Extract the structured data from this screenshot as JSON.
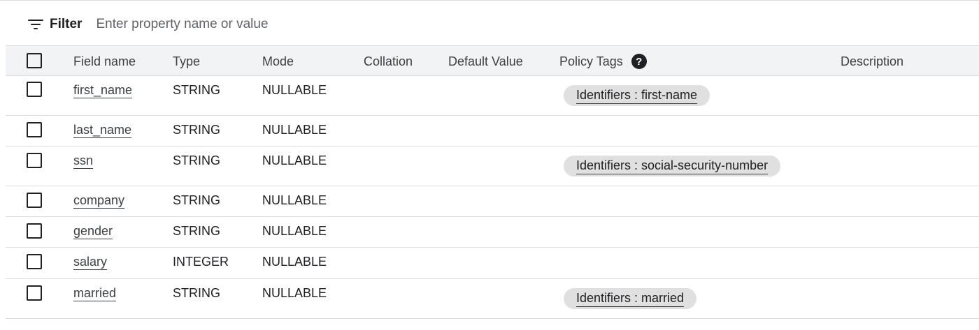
{
  "filter": {
    "label": "Filter",
    "placeholder": "Enter property name or value",
    "icon": "filter-list-icon"
  },
  "columns": {
    "field_name": "Field name",
    "type": "Type",
    "mode": "Mode",
    "collation": "Collation",
    "default_value": "Default Value",
    "policy_tags": "Policy Tags",
    "policy_tags_help": "?",
    "description": "Description"
  },
  "rows": [
    {
      "field_name": "first_name",
      "type": "STRING",
      "mode": "NULLABLE",
      "collation": "",
      "default_value": "",
      "policy_tag": "Identifiers : first-name",
      "description": ""
    },
    {
      "field_name": "last_name",
      "type": "STRING",
      "mode": "NULLABLE",
      "collation": "",
      "default_value": "",
      "policy_tag": "",
      "description": ""
    },
    {
      "field_name": "ssn",
      "type": "STRING",
      "mode": "NULLABLE",
      "collation": "",
      "default_value": "",
      "policy_tag": "Identifiers : social-security-number",
      "description": ""
    },
    {
      "field_name": "company",
      "type": "STRING",
      "mode": "NULLABLE",
      "collation": "",
      "default_value": "",
      "policy_tag": "",
      "description": ""
    },
    {
      "field_name": "gender",
      "type": "STRING",
      "mode": "NULLABLE",
      "collation": "",
      "default_value": "",
      "policy_tag": "",
      "description": ""
    },
    {
      "field_name": "salary",
      "type": "INTEGER",
      "mode": "NULLABLE",
      "collation": "",
      "default_value": "",
      "policy_tag": "",
      "description": ""
    },
    {
      "field_name": "married",
      "type": "STRING",
      "mode": "NULLABLE",
      "collation": "",
      "default_value": "",
      "policy_tag": "Identifiers : married",
      "description": ""
    }
  ],
  "colors": {
    "header_bg": "#f1f3f4",
    "border": "#dadce0",
    "chip_bg": "#e0e0e0",
    "text": "#202124"
  }
}
